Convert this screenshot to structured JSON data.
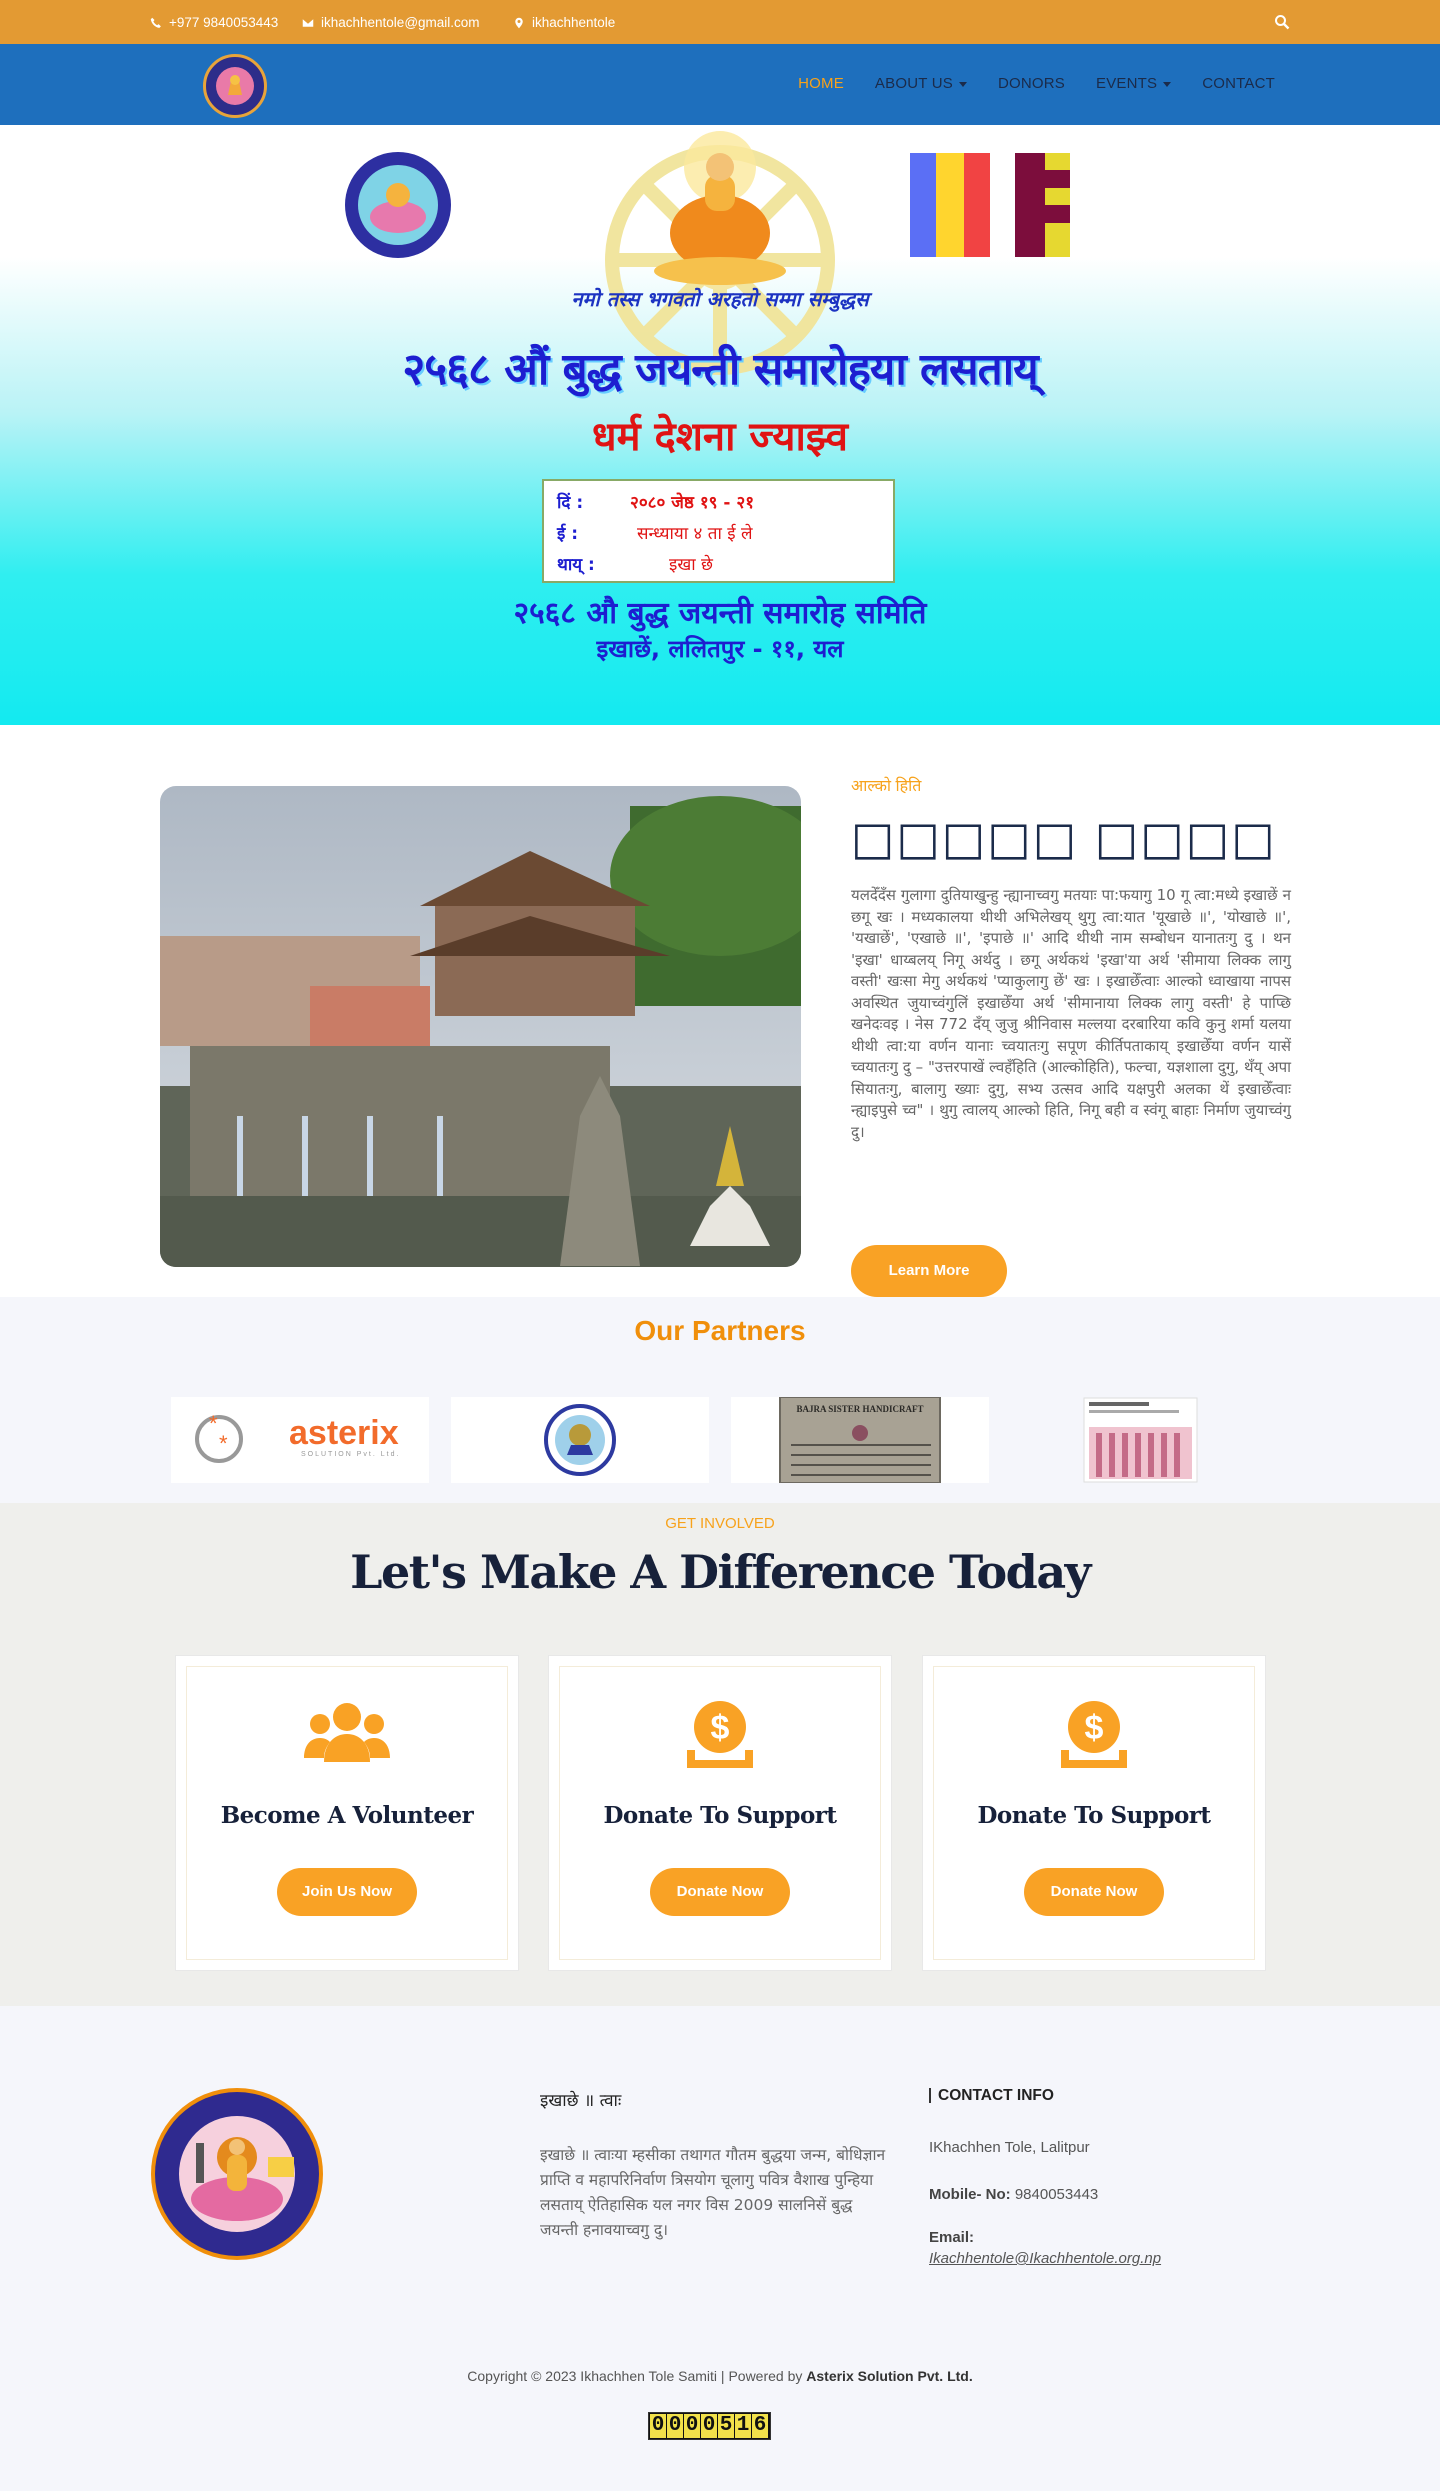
{
  "topbar": {
    "phone": "+977 9840053443",
    "email": "ikhachhentole@gmail.com",
    "location": "ikhachhentole",
    "icons": [
      "phone-icon",
      "envelope-icon",
      "map-marker-icon",
      "search-icon"
    ]
  },
  "nav": {
    "items": [
      {
        "label": "HOME",
        "active": true,
        "dropdown": false
      },
      {
        "label": "ABOUT US",
        "active": false,
        "dropdown": true
      },
      {
        "label": "DONORS",
        "active": false,
        "dropdown": false
      },
      {
        "label": "EVENTS",
        "active": false,
        "dropdown": true
      },
      {
        "label": "CONTACT",
        "active": false,
        "dropdown": false
      }
    ]
  },
  "hero": {
    "line1": "नमो तस्स भगवतो अरहतो सम्मा सम्बुद्धस",
    "line2": "२५६८ औं बुद्ध जयन्ती समारोहया लसताय्",
    "line3": "धर्म देशना ज्याझ्व",
    "info_labels": [
      "दिं :",
      "ई :",
      "थाय् :"
    ],
    "info_values": [
      "२०८० जेष्ठ १९ - २१",
      "सन्ध्याया ४ ता ई ले",
      "इखा छे"
    ],
    "line4": "२५६८ औ बुद्ध जयन्ती समारोह समिति",
    "line5": "इखाछें, ललितपुर - ११, यल"
  },
  "about": {
    "kicker": "आल्को हिति",
    "heading": "□□□□□ □□□□",
    "body": "यलदेँदँस गुलागा दुतियाखुन्हु न्ह्यानाच्वगु मतयाः पा:फयागु 10 गू त्वा:मध्ये इखाछें न छगू खः । मध्यकालया थीथी अभिलेखय् थुगु त्वा:यात 'यूखाछे ॥', 'योखाछे ॥', 'यखाछें', 'एखाछे ॥', 'इपाछे ॥' आदि थीथी नाम सम्बोधन यानातःगु दु । थन 'इखा' धाय्बलय् निगू अर्थदु । छगू अर्थकथं 'इखा'या अर्थ 'सीमाया लिक्क लागु वस्ती' खःसा मेगु अर्थकथं 'प्याकुलागु छें' खः । इखाछेँत्वाः आल्को ध्वाखाया नापस अवस्थित जुयाच्वंगुलिं इखाछेँया अर्थ 'सीमानाया लिक्क लागु वस्ती' हे पाप्छि खनेदःवइ । नेस 772 दँय् जुजु श्रीनिवास मल्लया दरबारिया कवि कुनु शर्मा यलया थीथी त्वा:या वर्णन यानाः च्वयातःगु सपूण कीर्तिपताकाय् इखाछेँया वर्णन यासें च्वयातःगु दु – \"उत्तरपाखें ल्वहँहिति (आल्कोहिति), फल्चा, यज्ञशाला दुगु, थँय् अपा सियातःगु, बालागु ख्याः दुगु, सभ्य उत्सव आदि यक्षपुरी अलका थें इखाछेँत्वाः न्ह्याइपुसे च्व\" । थुगु त्वालय् आल्को हिति, निगू बही व स्वंगू बाहाः निर्माण जुयाच्वंगु दु।",
    "button": "Learn More"
  },
  "partners": {
    "title": "Our Partners",
    "logos": [
      "asterix",
      "ikhachhen-tole-samiti",
      "bajra-sister-handicraft",
      "fashion-post"
    ],
    "asterix_name": "asterix",
    "asterix_sub": "SOLUTION Pvt. Ltd.",
    "bajra_name": "BAJRA SISTER HANDICRAFT"
  },
  "involved": {
    "kicker": "GET INVOLVED",
    "title": "Let's Make A Difference Today",
    "cards": [
      {
        "title": "Become A Volunteer",
        "button": "Join Us Now",
        "icon": "users-icon"
      },
      {
        "title": "Donate To Support",
        "button": "Donate Now",
        "icon": "donate-icon"
      },
      {
        "title": "Donate To Support",
        "button": "Donate Now",
        "icon": "donate-icon"
      }
    ]
  },
  "footer": {
    "about_title": "इखाछे ॥ त्वाः",
    "about_text": "इखाछे ॥ त्वाःया म्हसीका तथागत गौतम बुद्धया जन्म, बोधिज्ञान प्राप्ति व महापरिनिर्वाण त्रिसयोग चूलागु पवित्र वैशाख पुन्हिया लसताय् ऐतिहासिक यल नगर विस 2009 सालनिसें बुद्ध जयन्ती हनावयाच्वगु दु।",
    "contact_title": "CONTACT INFO",
    "address": "IKhachhen Tole, Lalitpur",
    "mobile_label": "Mobile- No:",
    "mobile": "9840053443",
    "email_label": "Email:",
    "email": "Ikachhentole@Ikachhentole.org.np",
    "copyright": "Copyright © 2023 Ikhachhen Tole Samiti | Powered by",
    "powered": "Asterix Solution Pvt. Ltd.",
    "counter": "0000516"
  },
  "colors": {
    "topbar": "#e39a33",
    "navbar": "#1e6fbd",
    "accent": "#f9a225",
    "heading": "#17213a"
  }
}
